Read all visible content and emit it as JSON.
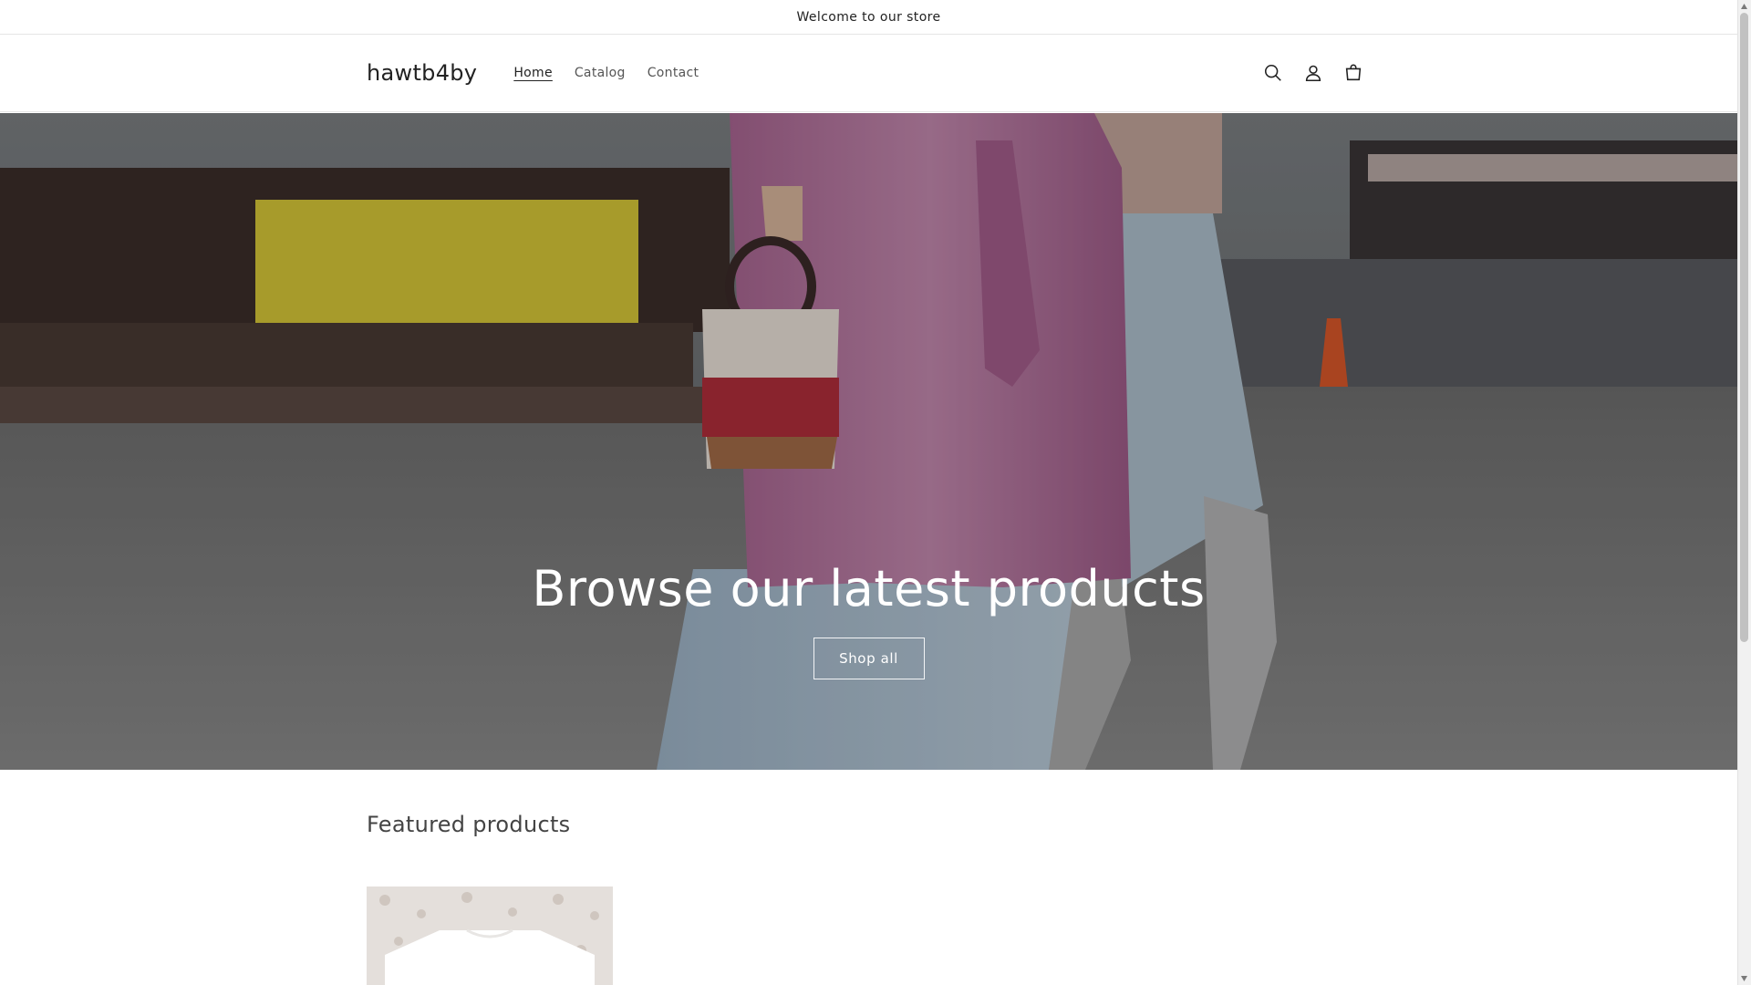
{
  "announcement": {
    "text": "Welcome to our store"
  },
  "header": {
    "logo": "hawtb4by",
    "nav": [
      {
        "label": "Home",
        "active": true
      },
      {
        "label": "Catalog",
        "active": false
      },
      {
        "label": "Contact",
        "active": false
      }
    ],
    "icons": [
      "search-icon",
      "account-icon",
      "cart-icon"
    ]
  },
  "hero": {
    "title": "Browse our latest products",
    "button_label": "Shop all"
  },
  "featured": {
    "heading": "Featured products"
  },
  "colors": {
    "text": "#121212",
    "coat": "#b77aa0",
    "trousers": "#a9bfd1",
    "yellow_wall": "#d8c93a"
  }
}
